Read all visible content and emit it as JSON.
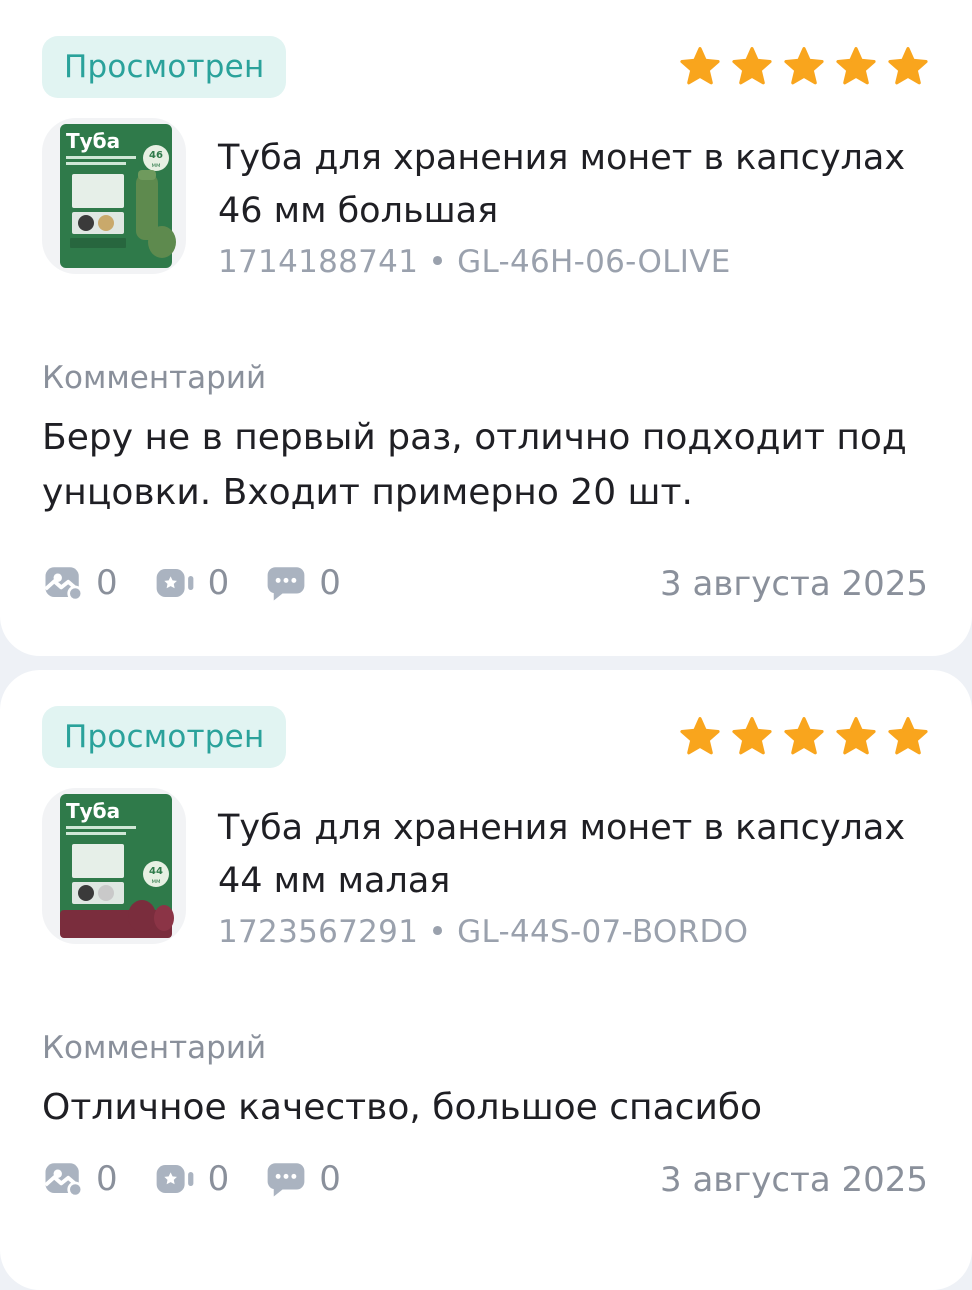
{
  "reviews": [
    {
      "status": "Просмотрен",
      "rating": 5,
      "product": {
        "title": "Туба для хранения монет в капсулах 46 мм большая",
        "sku": "1714188741 • GL-46H-06-OLIVE",
        "image_heading": "Туба",
        "image_size": "46",
        "image_unit": "мм",
        "image_color": "#5e8a4e"
      },
      "comment_label": "Комментарий",
      "comment": "Беру не в первый раз, отлично подходит под унцовки. Входит примерно 20 шт.",
      "stats": {
        "photos": "0",
        "videos": "0",
        "comments": "0"
      },
      "date": "3 августа 2025"
    },
    {
      "status": "Просмотрен",
      "rating": 5,
      "product": {
        "title": "Туба для хранения монет в капсулах 44 мм малая",
        "sku": "1723567291 • GL-44S-07-BORDO",
        "image_heading": "Туба",
        "image_size": "44",
        "image_unit": "мм",
        "image_color": "#7a2d3d"
      },
      "comment_label": "Комментарий",
      "comment": "Отличное качество, большое спасибо",
      "stats": {
        "photos": "0",
        "videos": "0",
        "comments": "0"
      },
      "date": "3 августа 2025"
    }
  ],
  "colors": {
    "star": "#f9a51d",
    "badge_text": "#2aa29b",
    "badge_bg": "#e1f4f2",
    "muted": "#8a909b",
    "icon": "#aab3c0",
    "package_green": "#2f7a4a"
  }
}
